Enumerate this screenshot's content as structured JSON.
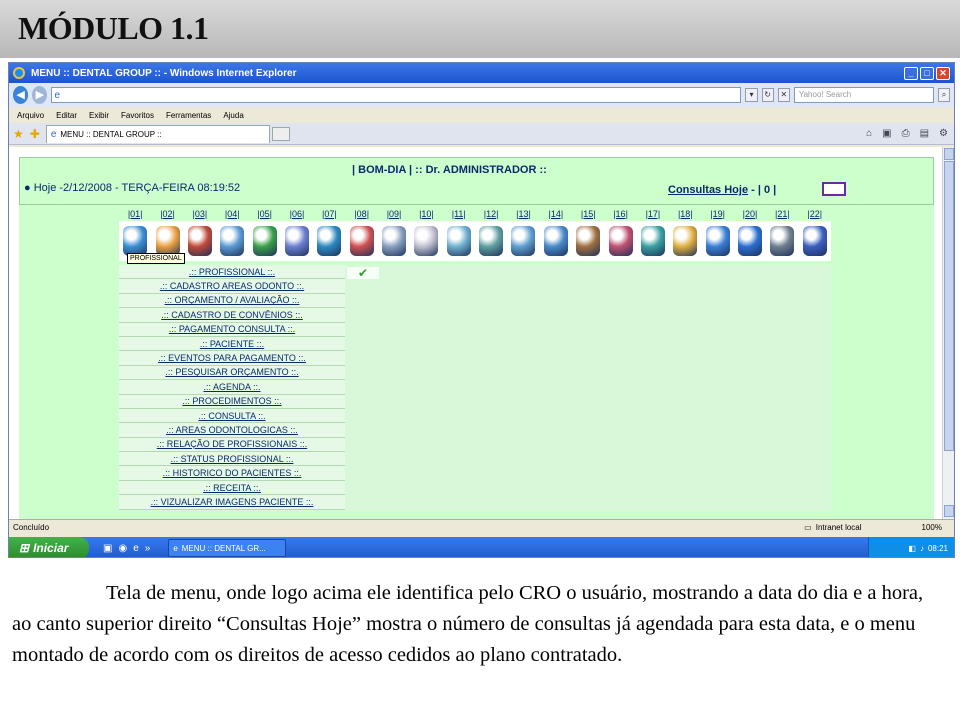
{
  "slide": {
    "title": "MÓDULO 1.1",
    "caption": "Tela de menu, onde logo acima ele identifica pelo CRO o usuário, mostrando a data do dia e a hora, ao canto superior direito “Consultas Hoje” mostra o número de consultas já agendada para esta data, e o menu montado de acordo com os direitos de acesso cedidos ao plano contratado."
  },
  "browser": {
    "window_title": "MENU :: DENTAL GROUP :: - Windows Internet Explorer",
    "search_placeholder": "Yahoo! Search",
    "menu": [
      "Arquivo",
      "Editar",
      "Exibir",
      "Favoritos",
      "Ferramentas",
      "Ajuda"
    ],
    "tab_label": "MENU :: DENTAL GROUP ::",
    "status_text": "Concluído",
    "zone": "Intranet local",
    "zoom": "100%",
    "start_label": "Iniciar",
    "task_label": "MENU :: DENTAL GR...",
    "clock": "08:21"
  },
  "app": {
    "greeting": "| BOM-DIA | :: Dr. ADMINISTRADOR ::",
    "date_line": "● Hoje -2/12/2008 - TERÇA-FEIRA     08:19:52",
    "consultas_label": "Consultas Hoje",
    "consultas_sep": " - ",
    "consultas_count": "| 0 |",
    "tooltip": "PROFISSIONAL",
    "tabs": [
      "|01|",
      "|02|",
      "|03|",
      "|04|",
      "|05|",
      "|06|",
      "|07|",
      "|08|",
      "|09|",
      "|10|",
      "|11|",
      "|12|",
      "|13|",
      "|14|",
      "|15|",
      "|16|",
      "|17|",
      "|18|",
      "|19|",
      "|20|",
      "|21|",
      "|22|"
    ],
    "icon_colors": [
      "#3b8fd6",
      "#e8a040",
      "#c04a3a",
      "#5b9bd5",
      "#3aa04a",
      "#6c7fd0",
      "#2c8ac0",
      "#d05050",
      "#8aa0c0",
      "#c0c0d0",
      "#6fb0d0",
      "#60a0a0",
      "#60a0d0",
      "#4a8ac8",
      "#a07040",
      "#c05070",
      "#3aa0a0",
      "#e0b040",
      "#3b7fd6",
      "#2c6fd0",
      "#708090",
      "#3b5fc0"
    ],
    "menu_items": [
      ".:: PROFISSIONAL ::.",
      ".:: CADASTRO AREAS ODONTO ::.",
      ".:: ORÇAMENTO / AVALIAÇÃO ::.",
      ".:: CADASTRO DE CONVÊNIOS ::.",
      ".:: PAGAMENTO CONSULTA ::.",
      ".:: PACIENTE ::.",
      ".:: EVENTOS PARA PAGAMENTO ::.",
      ".:: PESQUISAR ORÇAMENTO ::.",
      ".:: AGENDA ::.",
      ".:: PROCEDIMENTOS ::.",
      ".:: CONSULTA ::.",
      ".:: AREAS ODONTOLOGICAS ::.",
      ".:: RELAÇÃO DE PROFISSIONAIS ::.",
      ".:: STATUS PROFISSIONAL ::.",
      ".:: HISTORICO DO PACIENTES ::.",
      ".:: RECEITA ::.",
      ".:: VIZUALIZAR IMAGENS PACIENTE ::."
    ]
  }
}
